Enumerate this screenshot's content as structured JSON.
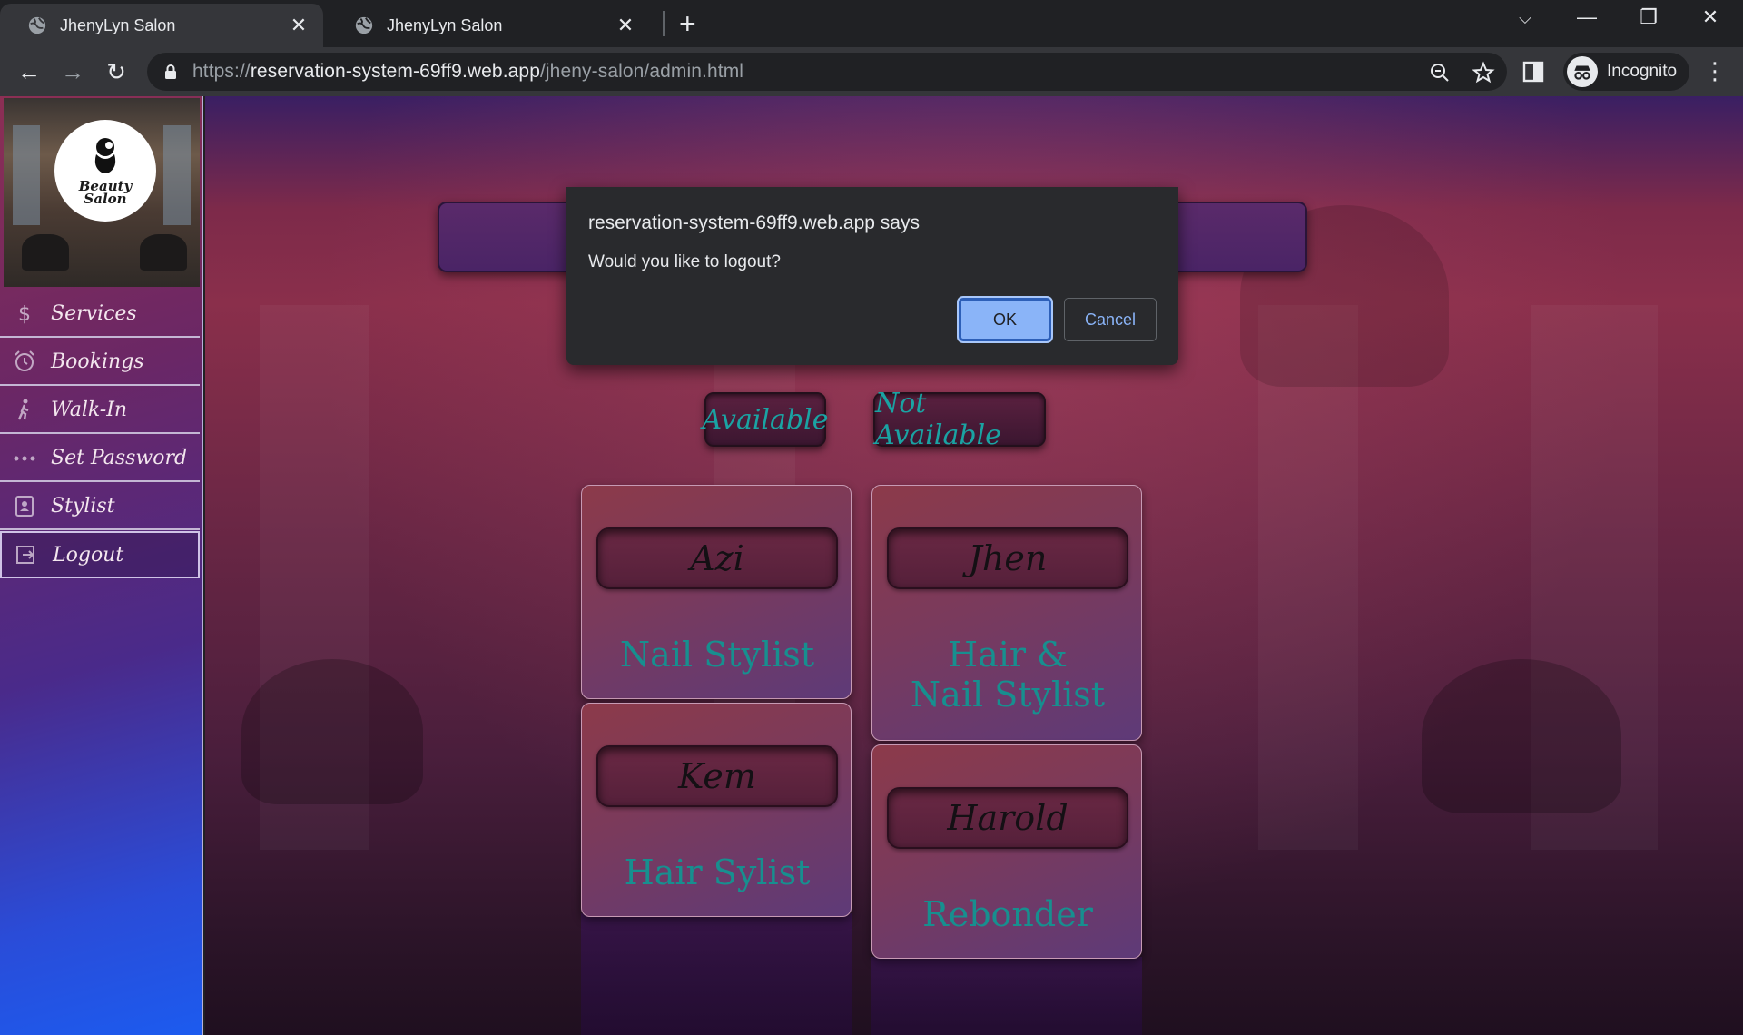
{
  "browser": {
    "tabs": [
      {
        "title": "JhenyLyn Salon",
        "active": true
      },
      {
        "title": "JhenyLyn Salon",
        "active": false
      }
    ],
    "url": {
      "scheme": "https://",
      "host": "reservation-system-69ff9.web.app",
      "path": "/jheny-salon/admin.html"
    },
    "profile_label": "Incognito"
  },
  "sidebar": {
    "logo_text_line1": "Beauty",
    "logo_text_line2": "Salon",
    "items": [
      {
        "label": "Services",
        "icon": "dollar-icon",
        "selected": false
      },
      {
        "label": "Bookings",
        "icon": "alarm-clock-icon",
        "selected": false
      },
      {
        "label": "Walk-In",
        "icon": "walking-person-icon",
        "selected": false
      },
      {
        "label": "Set Password",
        "icon": "password-dots-icon",
        "selected": false
      },
      {
        "label": "Stylist",
        "icon": "id-badge-icon",
        "selected": false
      },
      {
        "label": "Logout",
        "icon": "logout-icon",
        "selected": true
      }
    ]
  },
  "main": {
    "filters": {
      "available": "Available",
      "not_available": "Not Available"
    },
    "stylists": [
      {
        "name": "Azi",
        "role": "Nail Stylist"
      },
      {
        "name": "Jhen",
        "role": "Hair & Nail Stylist"
      },
      {
        "name": "Kem",
        "role": "Hair Sylist"
      },
      {
        "name": "Harold",
        "role": "Rebonder"
      }
    ]
  },
  "dialog": {
    "title": "reservation-system-69ff9.web.app says",
    "message": "Would you like to logout?",
    "ok_label": "OK",
    "cancel_label": "Cancel"
  },
  "colors": {
    "accent_teal": "#178f8f",
    "dialog_ok": "#8ab4f8"
  }
}
